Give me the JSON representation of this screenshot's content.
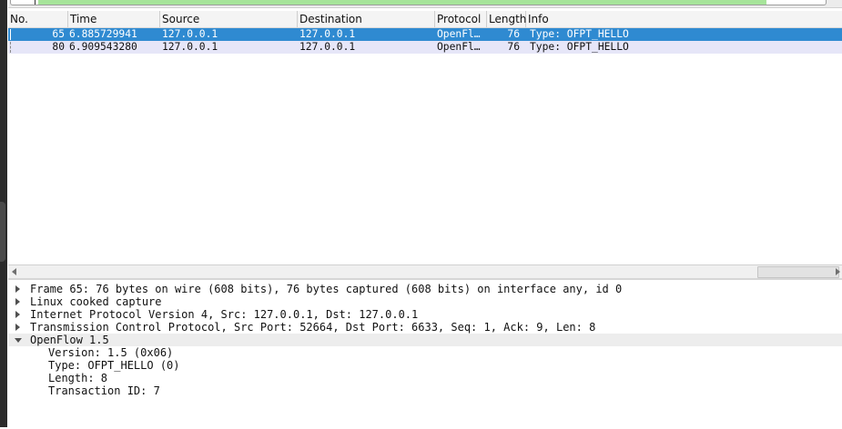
{
  "packet_list": {
    "columns": [
      "No.",
      "Time",
      "Source",
      "Destination",
      "Protocol",
      "Length",
      "Info"
    ],
    "rows": [
      {
        "no": "65",
        "time": "6.885729941",
        "source": "127.0.0.1",
        "destination": "127.0.0.1",
        "protocol": "OpenFl…",
        "length": "76",
        "info": "Type: OFPT_HELLO",
        "selected": true
      },
      {
        "no": "80",
        "time": "6.909543280",
        "source": "127.0.0.1",
        "destination": "127.0.0.1",
        "protocol": "OpenFl…",
        "length": "76",
        "info": "Type: OFPT_HELLO",
        "selected": false
      }
    ]
  },
  "details": {
    "nodes": [
      {
        "text": "Frame 65: 76 bytes on wire (608 bits), 76 bytes captured (608 bits) on interface any, id 0",
        "state": "collapsed"
      },
      {
        "text": "Linux cooked capture",
        "state": "collapsed"
      },
      {
        "text": "Internet Protocol Version 4, Src: 127.0.0.1, Dst: 127.0.0.1",
        "state": "collapsed"
      },
      {
        "text": "Transmission Control Protocol, Src Port: 52664, Dst Port: 6633, Seq: 1, Ack: 9, Len: 8",
        "state": "collapsed"
      },
      {
        "text": "OpenFlow 1.5",
        "state": "expanded"
      },
      {
        "text": "Version: 1.5 (0x06)",
        "state": "leaf"
      },
      {
        "text": "Type: OFPT_HELLO (0)",
        "state": "leaf"
      },
      {
        "text": "Length: 8",
        "state": "leaf"
      },
      {
        "text": "Transaction ID: 7",
        "state": "leaf"
      }
    ]
  },
  "colors": {
    "selected_row": "#2f8ad1",
    "alt_row": "#e6e6f8",
    "filter_valid": "#a6e49a"
  }
}
